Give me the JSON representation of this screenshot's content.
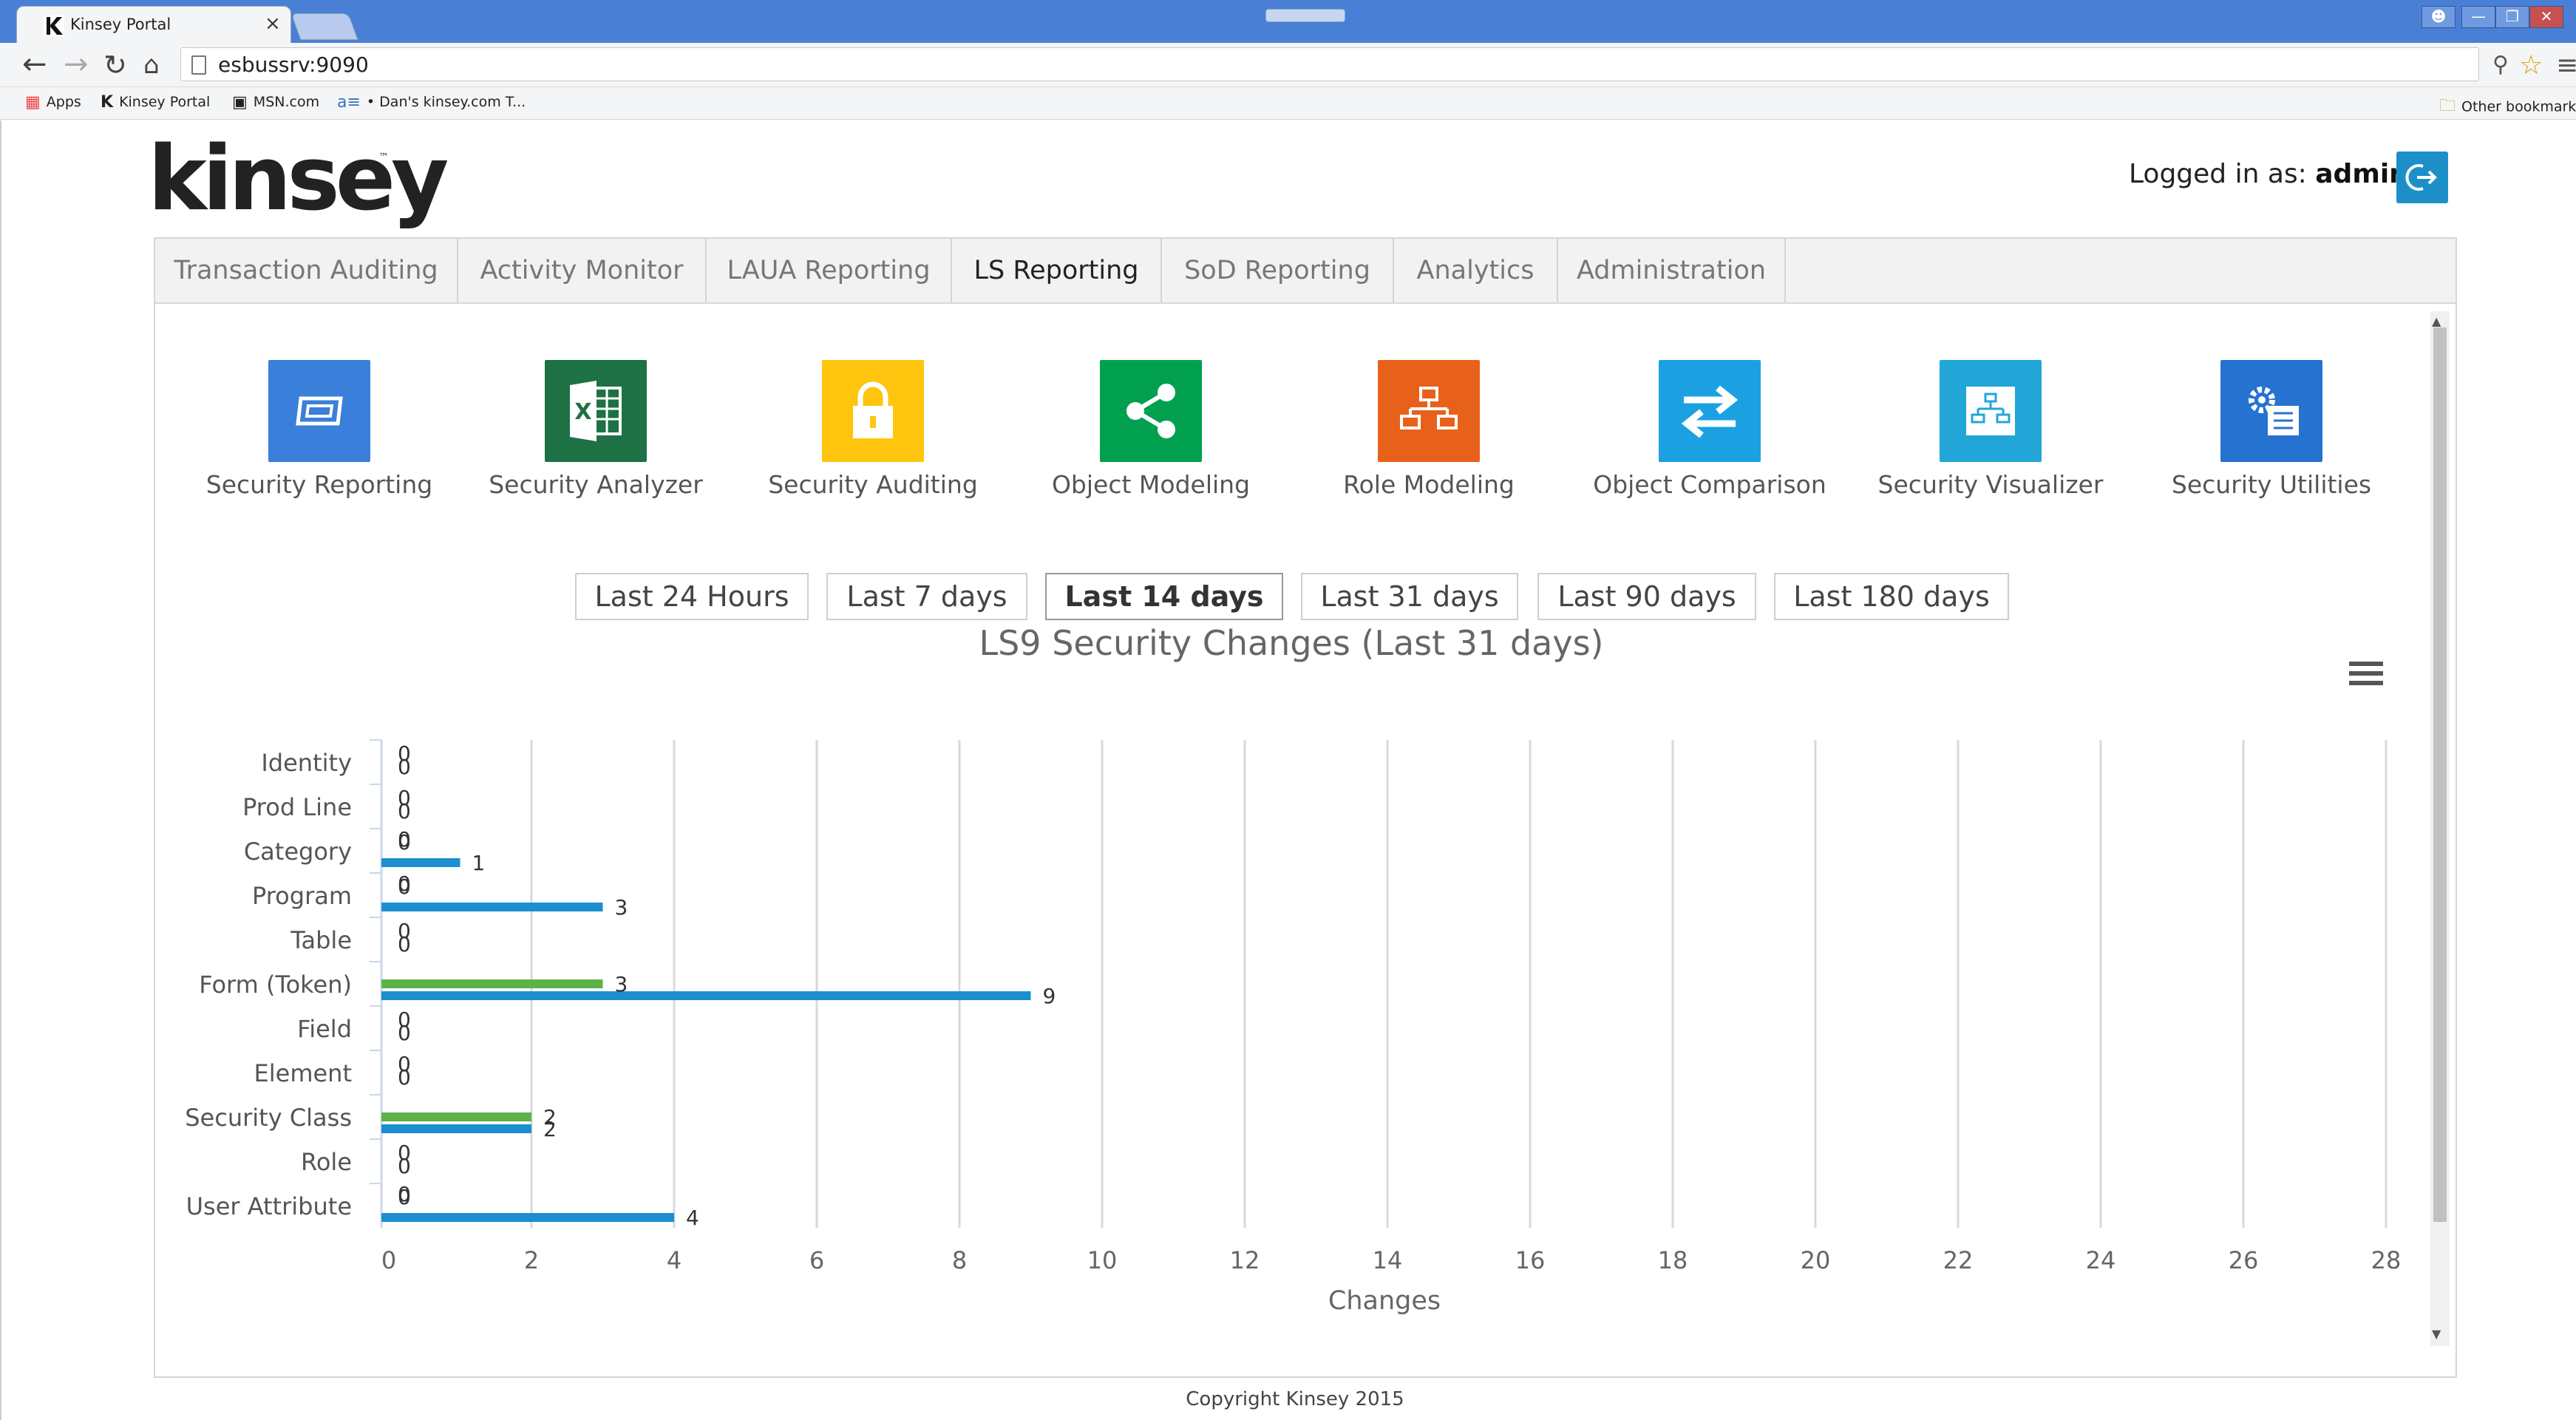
{
  "browser": {
    "tab_title": "Kinsey Portal",
    "tab_close": "×",
    "url": "esbussrv:9090",
    "bookmarks": [
      "Apps",
      "Kinsey Portal",
      "MSN.com",
      "• Dan's kinsey.com T..."
    ],
    "other_bookmarks": "Other bookmarks"
  },
  "header": {
    "logo": "kinsey",
    "logo_tm": "™",
    "logged_in_prefix": "Logged in as:",
    "user": "admin"
  },
  "nav": {
    "tabs": [
      "Transaction Auditing",
      "Activity Monitor",
      "LAUA Reporting",
      "LS Reporting",
      "SoD Reporting",
      "Analytics",
      "Administration"
    ],
    "active": "LS Reporting"
  },
  "tiles": [
    {
      "label": "Security Reporting",
      "color": "#3a7fd9",
      "icon": "report-screen-icon"
    },
    {
      "label": "Security Analyzer",
      "color": "#1e7145",
      "icon": "excel-icon"
    },
    {
      "label": "Security Auditing",
      "color": "#ffc40d",
      "icon": "lock-icon"
    },
    {
      "label": "Object Modeling",
      "color": "#00a04f",
      "icon": "share-icon"
    },
    {
      "label": "Role Modeling",
      "color": "#e8611a",
      "icon": "org-chart-icon"
    },
    {
      "label": "Object Comparison",
      "color": "#1ba1e2",
      "icon": "swap-arrows-icon"
    },
    {
      "label": "Security Visualizer",
      "color": "#22a6d8",
      "icon": "network-icon"
    },
    {
      "label": "Security Utilities",
      "color": "#2672d0",
      "icon": "settings-list-icon"
    }
  ],
  "ranges": {
    "buttons": [
      "Last 24 Hours",
      "Last 7 days",
      "Last 14 days",
      "Last 31 days",
      "Last 90 days",
      "Last 180 days"
    ],
    "active": "Last 14 days"
  },
  "chart_data": {
    "type": "bar",
    "orientation": "horizontal",
    "title": "LS9 Security Changes (Last 31 days)",
    "xlabel": "Changes",
    "ylabel": "",
    "xlim": [
      0,
      28
    ],
    "xticks": [
      0,
      2,
      4,
      6,
      8,
      10,
      12,
      14,
      16,
      18,
      20,
      22,
      24,
      26,
      28
    ],
    "grid": true,
    "categories": [
      "Identity",
      "Prod Line",
      "Category",
      "Program",
      "Table",
      "Form (Token)",
      "Field",
      "Element",
      "Security Class",
      "Role",
      "User Attribute"
    ],
    "series": [
      {
        "color": "#5cb345",
        "values": [
          0,
          0,
          0,
          0,
          0,
          3,
          0,
          0,
          2,
          0,
          0
        ]
      },
      {
        "color": "#1b8fcf",
        "values": [
          0,
          0,
          1,
          3,
          0,
          9,
          0,
          0,
          2,
          0,
          4
        ]
      }
    ]
  },
  "footer": "Copyright Kinsey 2015",
  "colors": {
    "titlebar": "#4a7fd6",
    "accent": "#1c8fc8",
    "series_green": "#5cb345",
    "series_blue": "#1b8fcf"
  }
}
